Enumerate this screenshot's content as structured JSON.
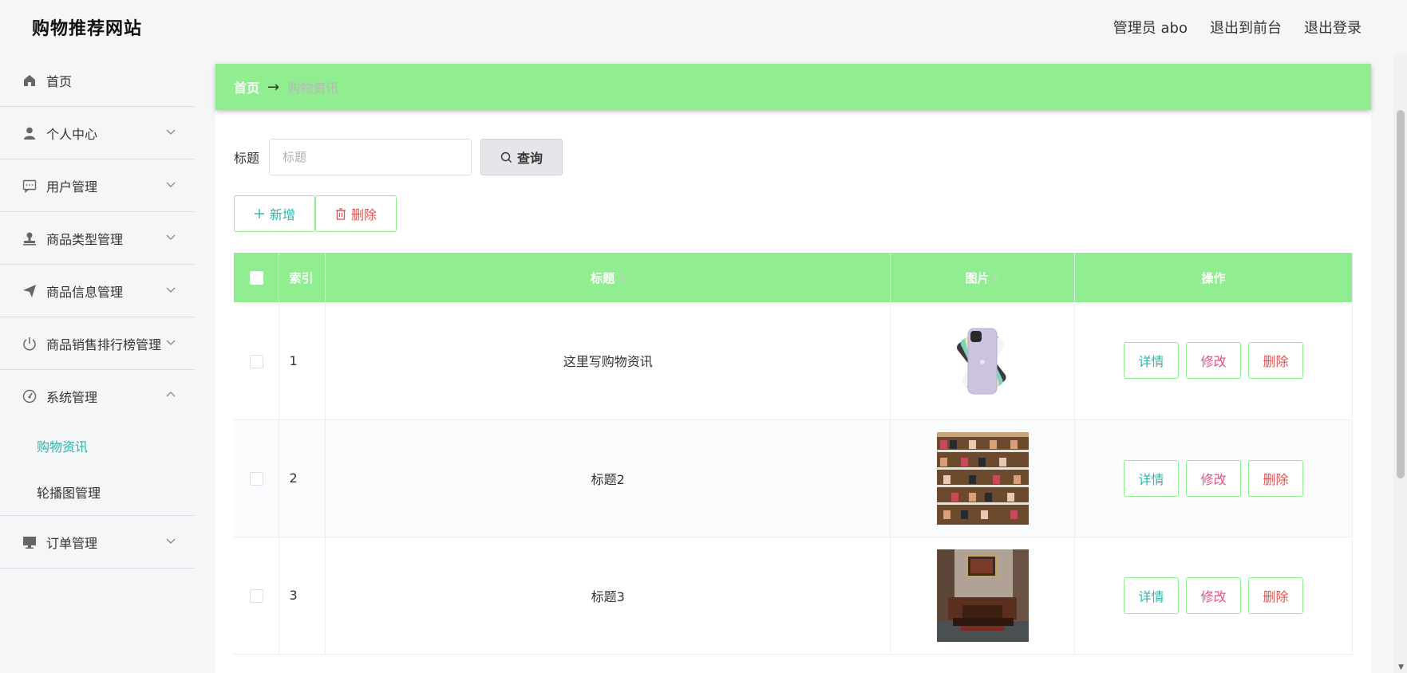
{
  "header": {
    "site_title": "购物推荐网站",
    "admin_label": "管理员 abo",
    "to_frontend": "退出到前台",
    "logout": "退出登录"
  },
  "sidebar": {
    "items": [
      {
        "label": "首页",
        "icon": "home-icon"
      },
      {
        "label": "个人中心",
        "icon": "user-icon"
      },
      {
        "label": "用户管理",
        "icon": "chat-icon"
      },
      {
        "label": "商品类型管理",
        "icon": "stamp-icon"
      },
      {
        "label": "商品信息管理",
        "icon": "send-icon"
      },
      {
        "label": "商品销售排行榜管理",
        "icon": "power-icon"
      },
      {
        "label": "系统管理",
        "icon": "gauge-icon"
      },
      {
        "label": "订单管理",
        "icon": "monitor-icon"
      }
    ],
    "system_submenu": [
      {
        "label": "购物资讯",
        "active": true
      },
      {
        "label": "轮播图管理",
        "active": false
      }
    ]
  },
  "breadcrumb": {
    "home": "首页",
    "arrow": "→",
    "current": "购物资讯"
  },
  "search": {
    "label": "标题",
    "placeholder": "标题",
    "value": "",
    "query_button": "查询"
  },
  "actions": {
    "add": "新增",
    "delete": "删除"
  },
  "table": {
    "headers": {
      "index": "索引",
      "title": "标题",
      "image": "图片",
      "operations": "操作"
    },
    "rows": [
      {
        "index": "1",
        "title": "这里写购物资讯",
        "image": "phone-image"
      },
      {
        "index": "2",
        "title": "标题2",
        "image": "shoe-rack-image"
      },
      {
        "index": "3",
        "title": "标题3",
        "image": "living-room-image"
      }
    ],
    "row_ops": {
      "detail": "详情",
      "edit": "修改",
      "delete": "删除"
    }
  },
  "colors": {
    "accent_green": "#90ee90",
    "teal_text": "#2bb5a8",
    "pink_text": "#e5507e",
    "red_text": "#e0524f"
  }
}
